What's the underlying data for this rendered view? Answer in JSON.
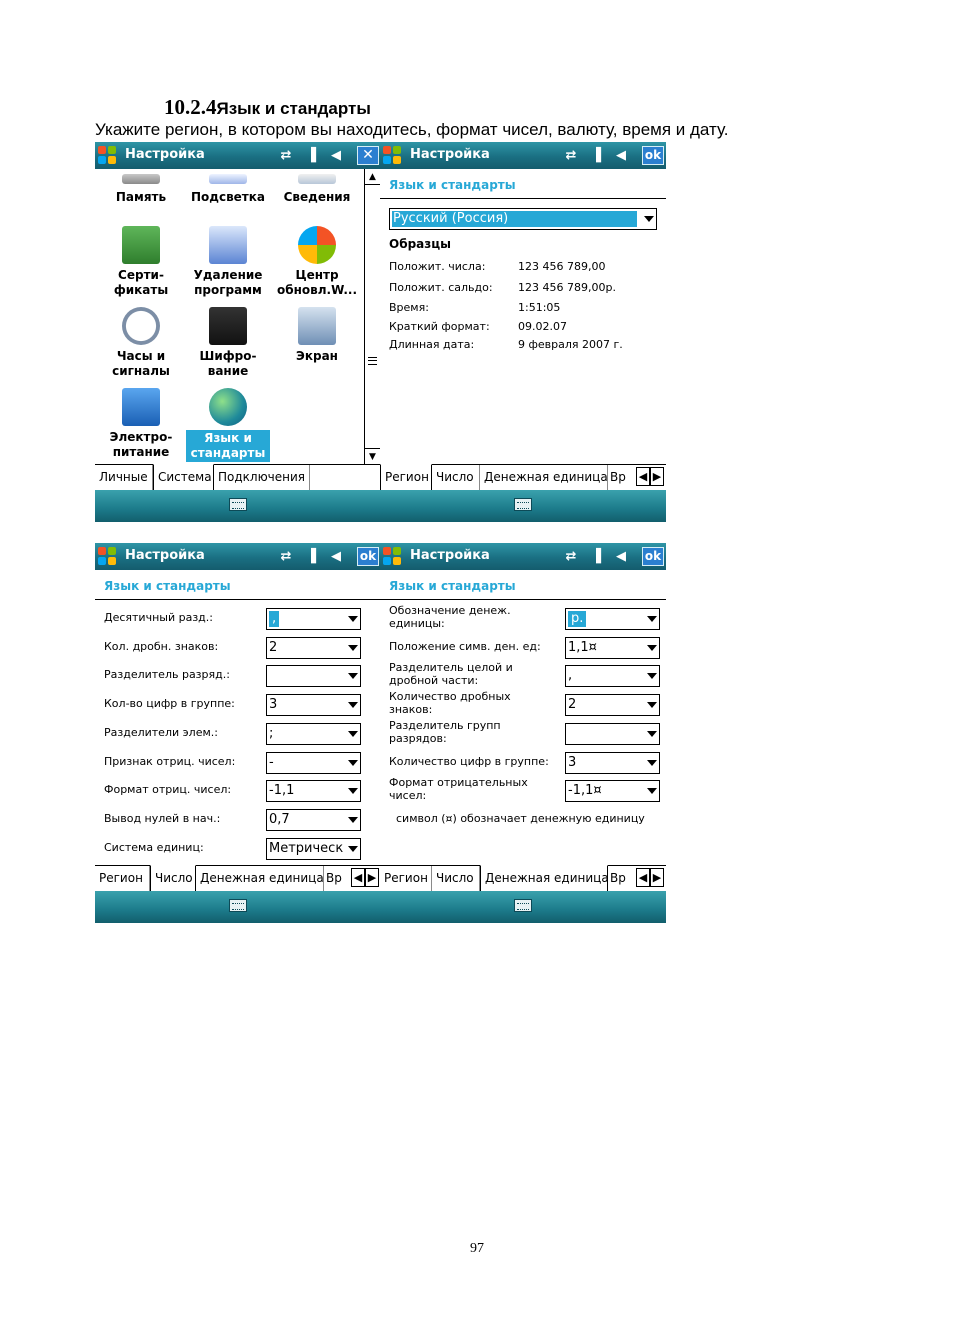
{
  "document": {
    "heading_number": "10.2.4",
    "heading_text": "Язык и стандарты",
    "intro": "Укажите регион, в котором вы находитесь, формат чисел, валюту, время и дату.",
    "page_number": "97"
  },
  "colors": {
    "titlebar": "#1a6f82",
    "accent": "#27a8d6",
    "ok_button": "#2b7fd0"
  },
  "screen1": {
    "title": "Настройка",
    "close": "✕",
    "grid": [
      {
        "label": "Память",
        "icon": "memory-icon"
      },
      {
        "label": "Подсветка",
        "icon": "backlight-icon"
      },
      {
        "label": "Сведения",
        "icon": "about-icon"
      },
      {
        "label": "Серти-\nфикаты",
        "icon": "certificates-icon"
      },
      {
        "label": "Удаление\nпрограмм",
        "icon": "remove-programs-icon"
      },
      {
        "label": "Центр\nобновл.W...",
        "icon": "windows-update-icon"
      },
      {
        "label": "Часы и\nсигналы",
        "icon": "clock-icon"
      },
      {
        "label": "Шифро-\nвание",
        "icon": "encryption-icon"
      },
      {
        "label": "Экран",
        "icon": "screen-icon"
      },
      {
        "label": "Электро-\nпитание",
        "icon": "power-icon"
      },
      {
        "label": "Язык и\nстандарты",
        "icon": "globe-icon",
        "selected": true
      }
    ],
    "tabs": [
      "Личные",
      "Система",
      "Подключения"
    ],
    "active_tab": 1
  },
  "screen2": {
    "title": "Настройка",
    "ok": "ok",
    "header": "Язык и стандарты",
    "region": "Русский (Россия)",
    "samples_title": "Образцы",
    "samples": [
      {
        "label": "Положит. числа:",
        "value": "123 456 789,00"
      },
      {
        "label": "Положит. сальдо:",
        "value": "123 456 789,00р."
      },
      {
        "label": "Время:",
        "value": "1:51:05"
      },
      {
        "label": "Краткий формат:",
        "value": "09.02.07"
      },
      {
        "label": "Длинная дата:",
        "value": "9 февраля 2007 г."
      }
    ],
    "tabs": [
      "Регион",
      "Число",
      "Денежная единица",
      "Вр"
    ],
    "active_tab": 0
  },
  "screen3": {
    "title": "Настройка",
    "ok": "ok",
    "header": "Язык и стандарты",
    "fields": [
      {
        "label": "Десятичный разд.:",
        "value": ",",
        "highlight": true
      },
      {
        "label": "Кол. дробн. знаков:",
        "value": "2"
      },
      {
        "label": "Разделитель разряд.:",
        "value": ""
      },
      {
        "label": "Кол-во цифр в группе:",
        "value": "3"
      },
      {
        "label": "Разделители элем.:",
        "value": ";"
      },
      {
        "label": "Признак отриц. чисел:",
        "value": "-"
      },
      {
        "label": "Формат отриц. чисел:",
        "value": "-1,1"
      },
      {
        "label": "Вывод нулей в нач.:",
        "value": "0,7"
      },
      {
        "label": "Система единиц:",
        "value": "Метрическ"
      }
    ],
    "tabs": [
      "Регион",
      "Число",
      "Денежная единица",
      "Вр"
    ],
    "active_tab": 1
  },
  "screen4": {
    "title": "Настройка",
    "ok": "ok",
    "header": "Язык и стандарты",
    "fields": [
      {
        "label": "Обозначение денеж.\nединицы:",
        "value": "р.",
        "highlight": true
      },
      {
        "label": "Положение симв. ден. ед:",
        "value": "1,1¤"
      },
      {
        "label": "Разделитель целой и\nдробной части:",
        "value": ","
      },
      {
        "label": "Количество дробных\nзнаков:",
        "value": "2"
      },
      {
        "label": "Разделитель групп\nразрядов:",
        "value": ""
      },
      {
        "label": "Количество цифр в группе:",
        "value": "3"
      },
      {
        "label": "Формат отрицательных\nчисел:",
        "value": "-1,1¤"
      }
    ],
    "note": "символ (¤) обозначает денежную единицу",
    "tabs": [
      "Регион",
      "Число",
      "Денежная единица",
      "Вр"
    ],
    "active_tab": 2
  }
}
